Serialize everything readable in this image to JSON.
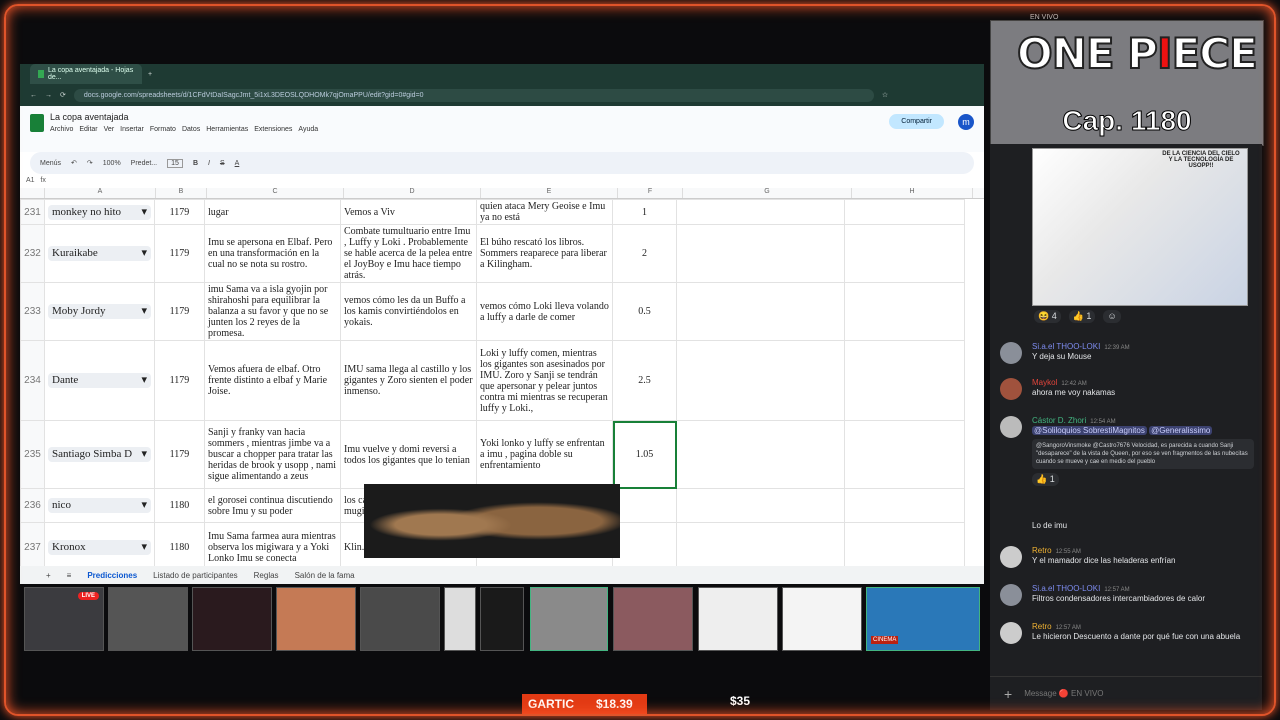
{
  "browser": {
    "tab_title": "La copa aventajada - Hojas de...",
    "url": "docs.google.com/spreadsheets/d/1CFdVtDaISagcJmt_5i1xL3DEOSLQDHOMk7qjOmaPPU/edit?gid=0#gid=0"
  },
  "sheet": {
    "title": "La copa aventajada",
    "menus": [
      "Archivo",
      "Editar",
      "Ver",
      "Insertar",
      "Formato",
      "Datos",
      "Herramientas",
      "Extensiones",
      "Ayuda"
    ],
    "share_label": "Compartir",
    "account_initial": "m",
    "toolbar": {
      "menus": "Menús",
      "zoom": "100%",
      "font": "Predet...",
      "font_size": "15"
    },
    "cell_ref": "A1",
    "columns": [
      "A",
      "B",
      "C",
      "D",
      "E",
      "F",
      "G",
      "H"
    ],
    "rows": [
      {
        "n": "231",
        "name": "monkey no hito",
        "cap": "1179",
        "c": "lugar",
        "d": "Vemos a Viv",
        "e": "quien ataca Mery Geoise e Imu ya no está",
        "f": "1"
      },
      {
        "n": "232",
        "name": "Kuraikabe",
        "cap": "1179",
        "c": "Imu se apersona en Elbaf. Pero en una transformación en la cual no se nota su rostro.",
        "d": "Combate tumultuario entre Imu , Luffy y Loki . Probablemente se hable acerca de la pelea entre el JoyBoy e Imu hace tiempo atrás.",
        "e": "El búho rescató los libros. Sommers reaparece para liberar a Kilingham.",
        "f": "2"
      },
      {
        "n": "233",
        "name": "Moby Jordy",
        "cap": "1179",
        "c": "imu Sama va a isla gyojin por shirahoshi para equilibrar la balanza a su favor y que no se junten los 2 reyes de la promesa.",
        "d": "vemos cómo les da un Buffo a los kamis convirtiéndolos en yokais.",
        "e": "vemos cómo Loki lleva volando a luffy a darle de comer",
        "f": "0.5"
      },
      {
        "n": "234",
        "name": "Dante",
        "cap": "1179",
        "c": "Vemos afuera de elbaf. Otro frente distinto a elbaf y Marie Joise.",
        "d": "IMU sama llega al castillo y los gigantes y Zoro sienten el poder inmenso.",
        "e": "Loki y luffy comen, mientras los gigantes son asesinados por IMU. Zoro y Sanji se tendrán que apersonar y pelear juntos contra mi mientras se recuperan luffy y Loki.,",
        "f": "2.5"
      },
      {
        "n": "235",
        "name": "Santiago Simba D",
        "cap": "1179",
        "c": "Sanji y franky van hacia sommers , mientras jimbe va a buscar a chopper para tratar las heridas de brook y usopp , nami sigue alimentando a zeus",
        "d": "Imu vuelve y domi reversi a todos los gigantes que lo tenian",
        "e": "Yoki lonko y luffy se enfrentan a imu , pagina doble su enfrentamiento",
        "f": "1.05"
      },
      {
        "n": "236",
        "name": "nico",
        "cap": "1180",
        "c": "el gorosei continua discutiendo sobre Imu y su poder",
        "d": "los caballeros les dicen a los mugiw... todos...",
        "e": "",
        "f": ""
      },
      {
        "n": "237",
        "name": "Kronox",
        "cap": "1180",
        "c": "Imu Sama farmea aura mientras observa los migiwara y a Yoki Lonko Imu se conecta",
        "d": "Klin... regen... el Bl...",
        "e": "",
        "f": ""
      }
    ],
    "sheet_tabs": [
      "Predicciones",
      "Listado de participantes",
      "Reglas",
      "Salón de la fama"
    ]
  },
  "overlay": {
    "logo_a": "ONE P",
    "logo_b": "I",
    "logo_c": "ECE",
    "chapter": "Cap. 1180",
    "live_label": "EN VIVO"
  },
  "chat": {
    "manga_text": "DE LA CIENCIA DEL CIELO Y LA TECNOLOGÍA DE USOPP!!",
    "reactions1": [
      "😆 4",
      "👍 1",
      "☺"
    ],
    "messages": [
      {
        "name": "Si.a.el THOO-LOKI",
        "time": "12:39 AM",
        "text": "Y deja su Mouse",
        "color": "#7e8cf0"
      },
      {
        "name": "Maykol",
        "time": "12:42 AM",
        "text": "ahora me voy nakamas",
        "color": "#e0443b"
      },
      {
        "name": "Cástor D. Zhori",
        "time": "12:54 AM",
        "mention1": "@Soliloquios SobrestiMagnitos",
        "mention2": "@Generalissimo",
        "quote": "@SangoroVinsmoke @Castro7676 Velocidad, es parecida a cuando Sanji \"desaparece\" de la vista de Queen, por eso se ven fragmentos de las nubecitas cuando se mueve y cae en medio del pueblo",
        "reaction": "👍 1",
        "color": "#43b581"
      },
      {
        "name": "",
        "time": "",
        "text": "Lo de imu",
        "color": "#fff"
      },
      {
        "name": "Retro",
        "time": "12:55 AM",
        "text": "Y el mamador dice las heladeras enfrían",
        "color": "#f0b232"
      },
      {
        "name": "Si.a.el THOO-LOKI",
        "time": "12:57 AM",
        "text": "Filtros condensadores intercambiadores de calor",
        "color": "#7e8cf0"
      },
      {
        "name": "Retro",
        "time": "12:57 AM",
        "text": "Le hicieron Descuento a dante por qué fue con una abuela",
        "color": "#f0b232"
      }
    ],
    "input_placeholder": "Message 🔴 EN VIVO"
  },
  "thumbs": {
    "live_badge": "LIVE",
    "cinema_label": "CINEMA"
  },
  "bottom": {
    "gartic": "GARTIC",
    "amount1": "$18.39",
    "amount2": "$35"
  }
}
